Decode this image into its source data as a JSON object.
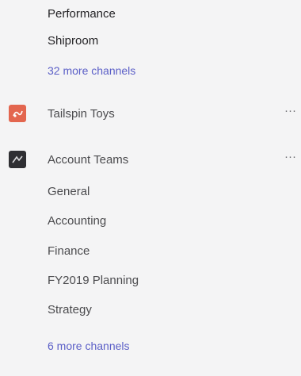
{
  "channel_list": {
    "top_channels": [
      "Performance",
      "Shiproom"
    ],
    "top_more_link": "32 more channels",
    "teams": [
      {
        "name": "Tailspin Toys",
        "avatar_color": "#e3664f",
        "avatar_icon": "tailspin-toys-logo-icon",
        "more_options": "···"
      },
      {
        "name": "Account Teams",
        "avatar_color": "#2f2f33",
        "avatar_icon": "account-teams-logo-icon",
        "more_options": "···",
        "channels": [
          "General",
          "Accounting",
          "Finance",
          "FY2019 Planning",
          "Strategy"
        ],
        "more_link": "6 more channels"
      }
    ]
  }
}
